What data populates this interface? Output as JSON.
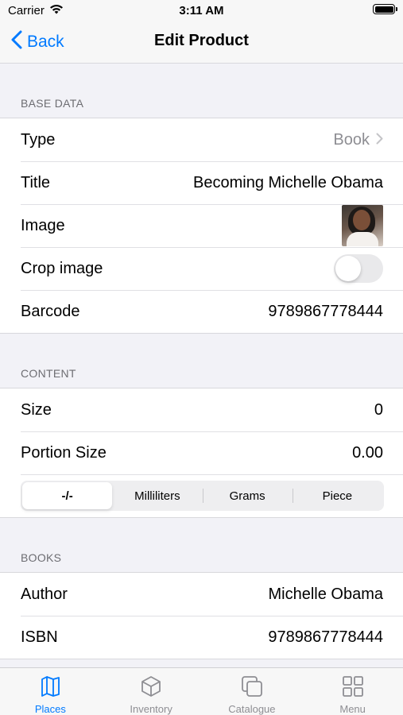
{
  "status_bar": {
    "carrier": "Carrier",
    "time": "3:11 AM"
  },
  "nav": {
    "back_label": "Back",
    "title": "Edit Product"
  },
  "sections": {
    "base_data": {
      "header": "BASE DATA",
      "type_label": "Type",
      "type_value": "Book",
      "title_label": "Title",
      "title_value": "Becoming Michelle Obama",
      "image_label": "Image",
      "crop_label": "Crop image",
      "crop_enabled": false,
      "barcode_label": "Barcode",
      "barcode_value": "9789867778444"
    },
    "content": {
      "header": "CONTENT",
      "size_label": "Size",
      "size_value": "0",
      "portion_label": "Portion Size",
      "portion_value": "0.00",
      "units": [
        "-/-",
        "Milliliters",
        "Grams",
        "Piece"
      ],
      "selected_unit": "-/-"
    },
    "books": {
      "header": "BOOKS",
      "author_label": "Author",
      "author_value": "Michelle Obama",
      "isbn_label": "ISBN",
      "isbn_value": "9789867778444"
    }
  },
  "tab_bar": {
    "tabs": [
      {
        "label": "Places",
        "icon": "places-icon",
        "active": true
      },
      {
        "label": "Inventory",
        "icon": "cube-icon",
        "active": false
      },
      {
        "label": "Catalogue",
        "icon": "stacked-squares-icon",
        "active": false
      },
      {
        "label": "Menu",
        "icon": "grid-icon",
        "active": false
      }
    ]
  },
  "colors": {
    "accent": "#007aff",
    "muted": "#8e8e93",
    "background": "#f2f2f7"
  }
}
